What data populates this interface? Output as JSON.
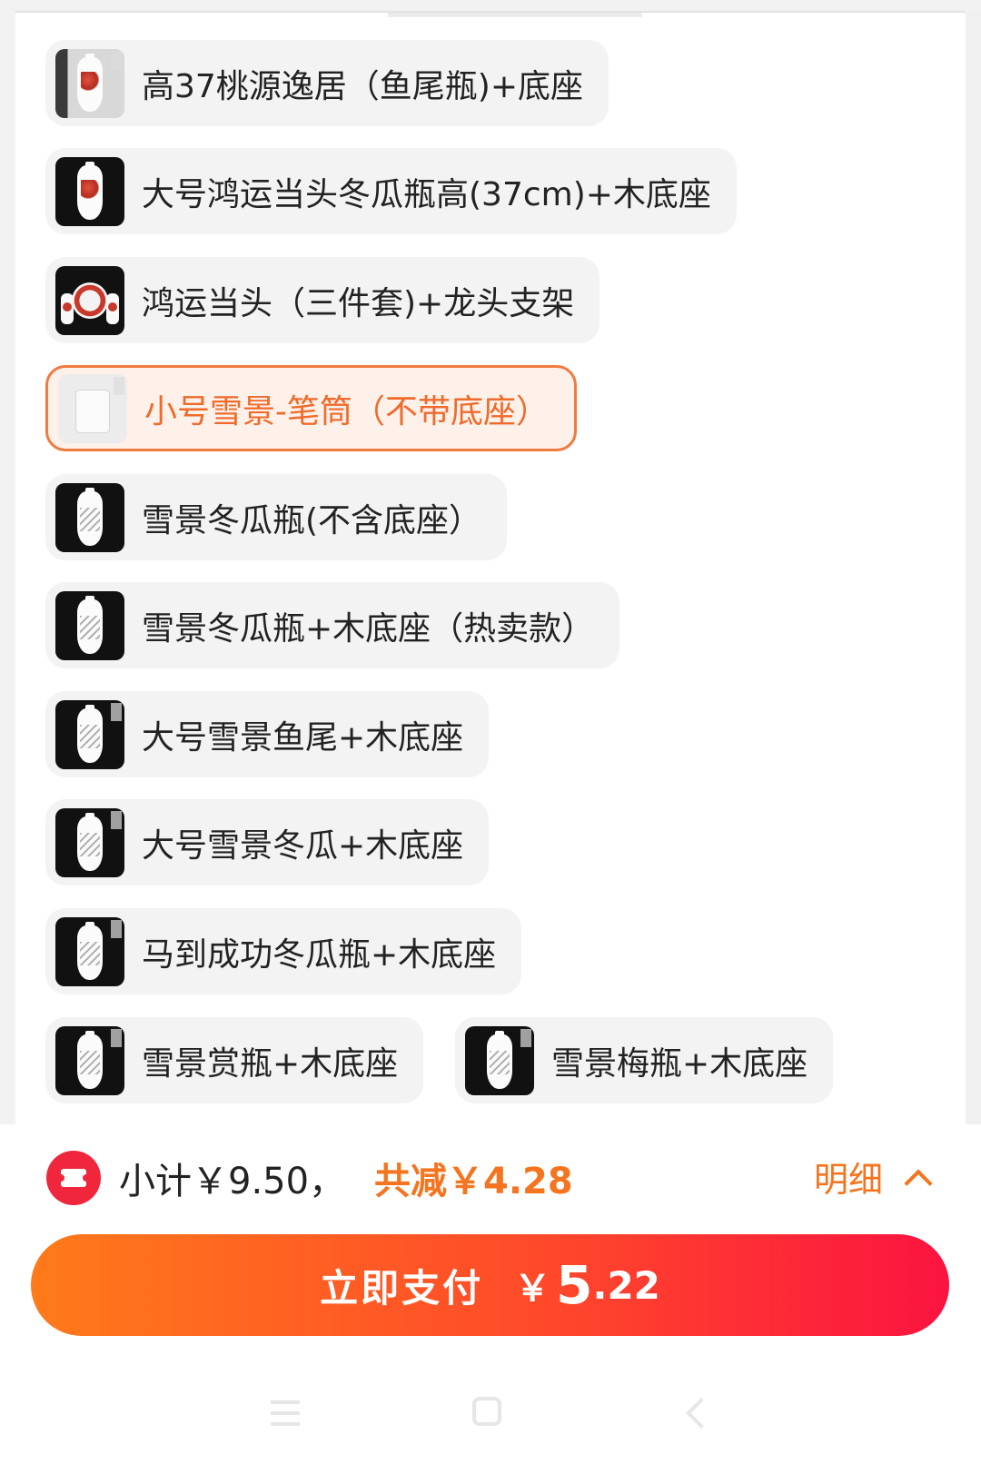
{
  "options": [
    {
      "label": "高37桃源逸居（鱼尾瓶)+底座",
      "icon": "fishtail-vase-thumbnail",
      "selected": false
    },
    {
      "label": "大号鸿运当头冬瓜瓶高(37cm)+木底座",
      "icon": "red-vase-thumbnail",
      "selected": false
    },
    {
      "label": "鸿运当头（三件套)+龙头支架",
      "icon": "three-piece-set-thumbnail",
      "selected": false
    },
    {
      "label": "小号雪景-笔筒（不带底座）",
      "icon": "brush-pot-thumbnail",
      "selected": true
    },
    {
      "label": "雪景冬瓜瓶(不含底座）",
      "icon": "snow-vase-thumbnail",
      "selected": false
    },
    {
      "label": "雪景冬瓜瓶+木底座（热卖款）",
      "icon": "snow-vase-stand-thumbnail",
      "selected": false
    },
    {
      "label": "大号雪景鱼尾+木底座",
      "icon": "large-fishtail-vase-thumbnail",
      "selected": false
    },
    {
      "label": "大号雪景冬瓜+木底座",
      "icon": "large-snow-vase-thumbnail",
      "selected": false
    },
    {
      "label": "马到成功冬瓜瓶+木底座",
      "icon": "horse-vase-thumbnail",
      "selected": false
    },
    {
      "label": "雪景赏瓶+木底座",
      "icon": "appreciation-vase-thumbnail",
      "selected": false
    },
    {
      "label": "雪景梅瓶+木底座",
      "icon": "plum-vase-thumbnail",
      "selected": false
    }
  ],
  "footer": {
    "subtotal": "小计￥9.50，",
    "discount": "共减￥4.28",
    "detail": "明细",
    "pay_label": "立即支付",
    "pay_yen": "￥",
    "pay_int": "5",
    "pay_dec": ".22"
  },
  "colors": {
    "accent": "#f5741f",
    "pay_start": "#ff7a1a",
    "pay_end": "#fb1340",
    "coupon": "#f0263c"
  }
}
